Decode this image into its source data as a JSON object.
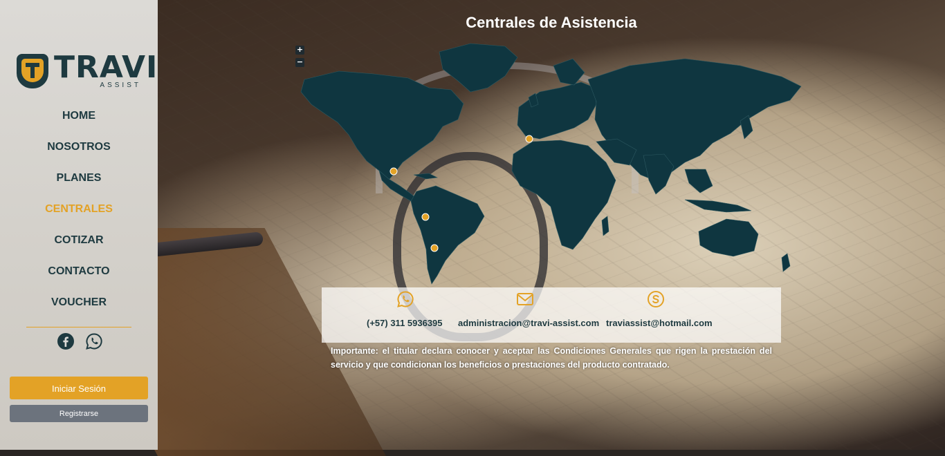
{
  "brand": {
    "name": "TRAVI",
    "tagline": "ASSIST"
  },
  "nav": {
    "items": [
      {
        "label": "HOME",
        "active": false
      },
      {
        "label": "NOSOTROS",
        "active": false
      },
      {
        "label": "PLANES",
        "active": false
      },
      {
        "label": "CENTRALES",
        "active": true
      },
      {
        "label": "COTIZAR",
        "active": false
      },
      {
        "label": "CONTACTO",
        "active": false
      },
      {
        "label": "VOUCHER",
        "active": false
      }
    ]
  },
  "socials": [
    {
      "icon": "facebook-icon"
    },
    {
      "icon": "whatsapp-icon"
    }
  ],
  "auth": {
    "login_label": "Iniciar Sesión",
    "register_label": "Registrarse"
  },
  "page": {
    "title": "Centrales de Asistencia"
  },
  "map": {
    "zoom_in": "+",
    "zoom_out": "−",
    "markers": [
      "Spain",
      "Mexico",
      "Peru",
      "Chile"
    ]
  },
  "contact": {
    "phone": "(+57) 311 5936395",
    "email": "administracion@travi-assist.com",
    "skype": "traviassist@hotmail.com"
  },
  "notice": "Importante: el titular declara conocer y aceptar las Condiciones Generales que rigen la prestación del servicio y que condicionan los beneficios o prestaciones del producto contratado.",
  "colors": {
    "accent": "#e3a226",
    "dark": "#1e3a40",
    "map_fill": "#0f3640",
    "button_secondary": "#6c737d"
  }
}
